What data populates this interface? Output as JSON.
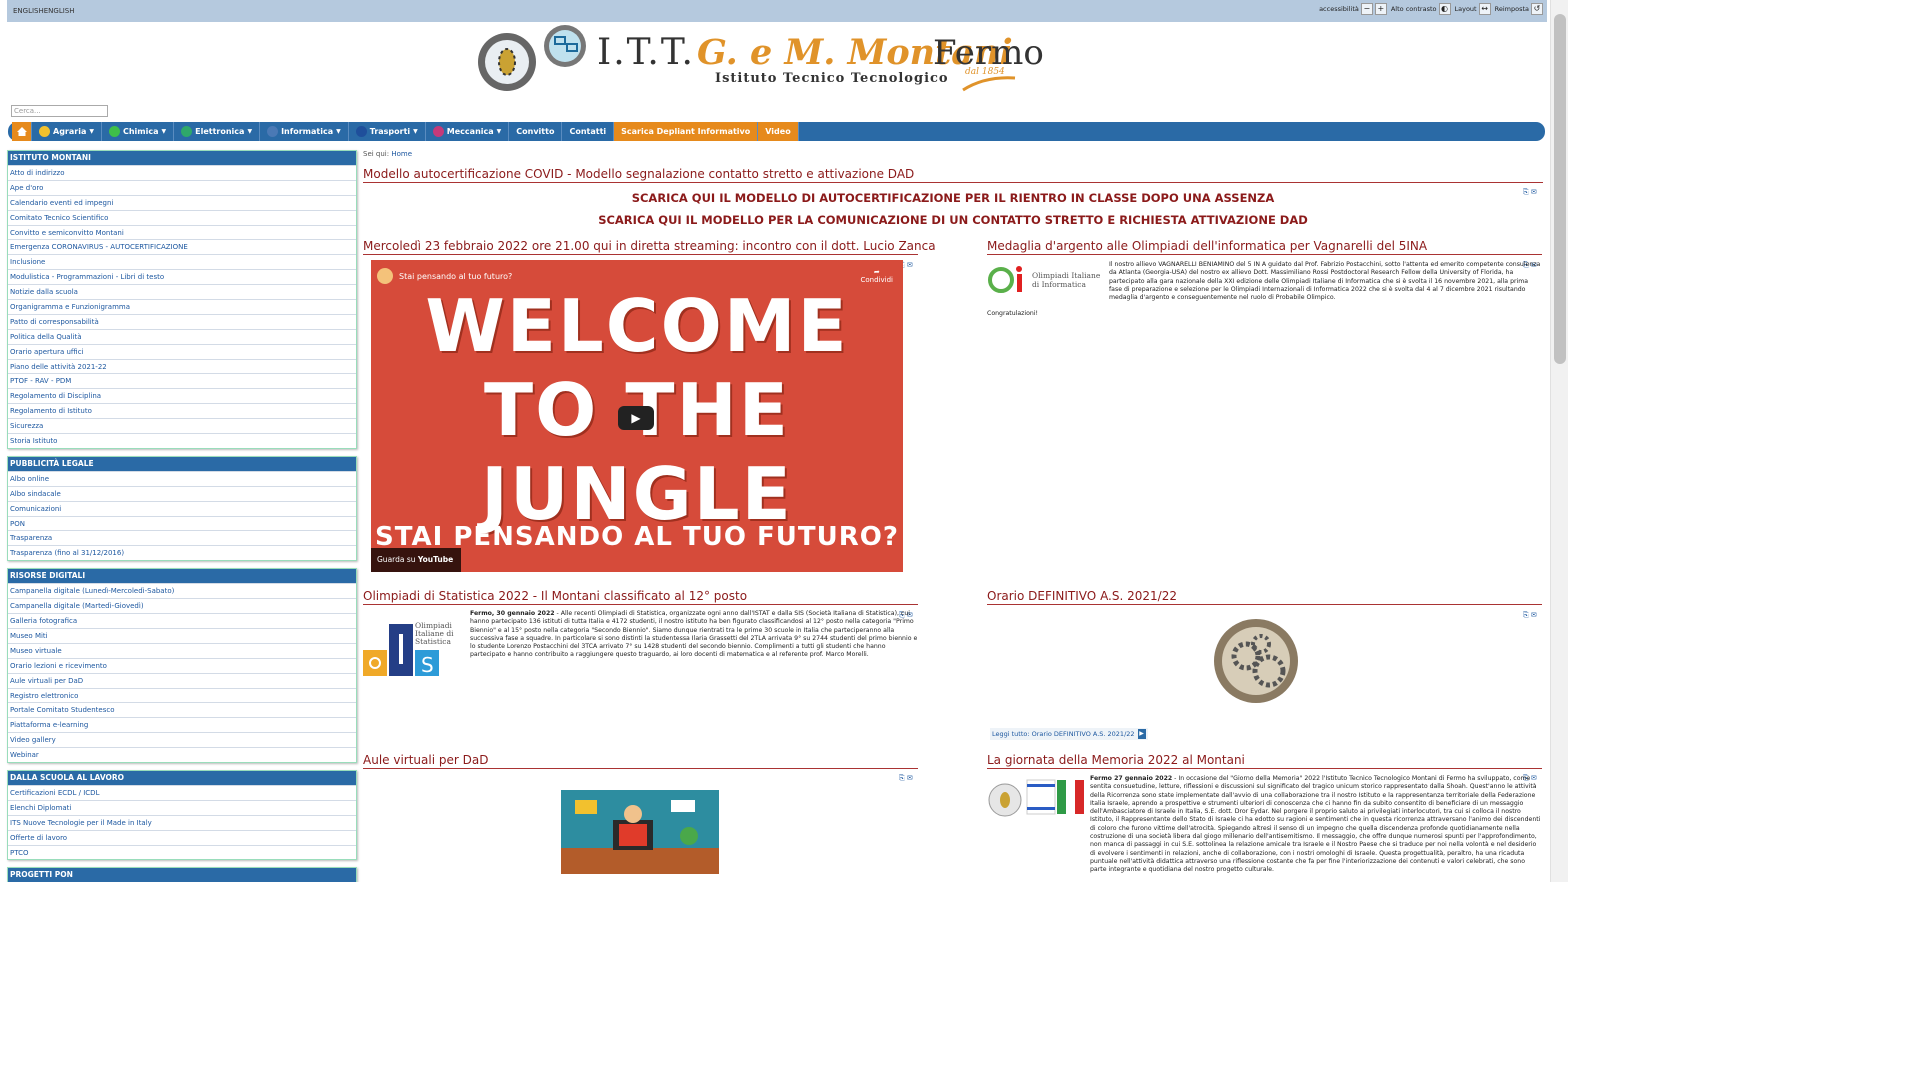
{
  "topbar": {
    "language": "ENGLISHENGLISH",
    "accessibility_label": "accessibilità",
    "zoom_out_icon": "zoom-out-icon",
    "zoom_in_icon": "zoom-in-icon",
    "contrast_label": "Alto contrasto",
    "layout_label": "Layout",
    "reset_label": "Reimposta"
  },
  "header": {
    "logo_prefix": "I.T.T.",
    "logo_name": "G. e M. Montani",
    "logo_city": "Fermo",
    "logo_subtitle": "Istituto Tecnico Tecnologico",
    "logo_since": "dal 1854"
  },
  "search": {
    "placeholder": "Cerca..."
  },
  "nav": [
    {
      "label": "Agraria",
      "color": "#f2c12e"
    },
    {
      "label": "Chimica",
      "color": "#3fbf4a"
    },
    {
      "label": "Elettronica",
      "color": "#2fa86b"
    },
    {
      "label": "Informatica",
      "color": "#4a79b5"
    },
    {
      "label": "Trasporti",
      "color": "#1f4f9b"
    },
    {
      "label": "Meccanica",
      "color": "#c43a7a"
    },
    {
      "label": "Convitto"
    },
    {
      "label": "Contatti"
    },
    {
      "label": "Scarica Depliant Informativo"
    },
    {
      "label": "Video"
    }
  ],
  "sidebar": [
    {
      "title": "ISTITUTO MONTANI",
      "items": [
        "Atto di indirizzo",
        "Ape d'oro",
        "Calendario eventi ed impegni",
        "Comitato Tecnico Scientifico",
        "Convitto e semiconvitto Montani",
        "Emergenza CORONAVIRUS - AUTOCERTIFICAZIONE",
        "Inclusione",
        "Modulistica - Programmazioni - Libri di testo",
        "Notizie dalla scuola",
        "Organigramma e Funzionigramma",
        "Patto di corresponsabilità",
        "Politica della Qualità",
        "Orario apertura uffici",
        "Piano delle attività 2021-22",
        "PTOF - RAV - PDM",
        "Regolamento di Disciplina",
        "Regolamento di Istituto",
        "Sicurezza",
        "Storia Istituto"
      ]
    },
    {
      "title": "PUBBLICITÀ LEGALE",
      "items": [
        "Albo online",
        "Albo sindacale",
        "Comunicazioni",
        "PON",
        "Trasparenza",
        "Trasparenza (fino al 31/12/2016)"
      ]
    },
    {
      "title": "RISORSE DIGITALI",
      "items": [
        "Campanella digitale (Lunedì-Mercoledì-Sabato)",
        "Campanella digitale (Martedì-Giovedì)",
        "Galleria fotografica",
        "Museo Miti",
        "Museo virtuale",
        "Orario lezioni e ricevimento",
        "Aule virtuali per DaD",
        "Registro elettronico",
        "Portale Comitato Studentesco",
        "Piattaforma e-learning",
        "Video gallery",
        "Webinar"
      ]
    },
    {
      "title": "DALLA SCUOLA AL LAVORO",
      "items": [
        "Certificazioni ECDL / ICDL",
        "Elenchi Diplomati",
        "ITS Nuove Tecnologie per il Made in Italy",
        "Offerte di lavoro",
        "PTCO"
      ]
    },
    {
      "title": "PROGETTI PON",
      "items": []
    }
  ],
  "main": {
    "breadcrumb_prefix": "Sei qui:",
    "breadcrumb_home": "Home",
    "covid_title": "Modello autocertificazione COVID - Modello segnalazione contatto stretto e attivazione DAD",
    "cta1": "SCARICA QUI IL MODELLO DI AUTOCERTIFICAZIONE PER IL RIENTRO IN CLASSE DOPO UNA ASSENZA",
    "cta2": "SCARICA QUI IL MODELLO PER LA COMUNICAZIONE DI UN CONTATTO STRETTO E RICHIESTA ATTIVAZIONE DAD",
    "streaming_title": "Mercoledì 23 febbraio 2022 ore 21.00 qui in diretta streaming: incontro con il dott. Lucio Zanca",
    "video": {
      "channel_title": "Stai pensando al tuo futuro?",
      "share": "Condividi",
      "big_text_1": "WELCOME",
      "big_text_2": "TO THE",
      "big_text_3": "JUNGLE",
      "sub_text": "STAI PENSANDO AL TUO FUTURO?",
      "watch_on": "Guarda su",
      "youtube": "YouTube"
    },
    "medal_title": "Medaglia d'argento alle Olimpiadi dell'informatica per Vagnarelli del 5INA",
    "medal_logo_text": "Olimpiadi Italiane di Informatica",
    "medal_text": "Il nostro allievo VAGNARELLI BENIAMINO del 5 IN A guidato dal Prof. Fabrizio Postacchini, sotto l'attenta ed emerito competente consulenza da Atlanta (Georgia-USA) del nostro ex allievo Dott. Massimiliano Rossi Postdoctoral Research Fellow della University of Florida, ha partecipato alla gara nazionale della XXI edizione delle Olimpiadi Italiane di Informatica che si è svolta il 16 novembre 2021, alla prima fase di preparazione e selezione per le Olimpiadi Internazionali di Informatica 2022 che si è svolta dal 4 al 7 dicembre 2021 risultando medaglia d'argento e conseguentemente nel ruolo di Probabile Olimpico.",
    "medal_congrats": "Congratulazioni!",
    "stat_title": "Olimpiadi di Statistica 2022 - Il Montani classificato al 12° posto",
    "stat_logo_text": "Olimpiadi Italiane di Statistica",
    "stat_lead": "Fermo, 30 gennaio 2022",
    "stat_text": " - Alle recenti Olimpiadi di Statistica, organizzate ogni anno dall'ISTAT e dalla SIS (Società Italiana di Statistica), cui hanno partecipato 136 istituti di tutta Italia e 4172 studenti, il nostro istituto ha ben figurato classificandosi al 12° posto nella categoria \"Primo Biennio\" e al 15° posto nella categoria \"Secondo Biennio\". Siamo dunque rientrati tra le prime 30 scuole in Italia che parteciperanno alla successiva fase a squadre. In particolare si sono distinti la studentessa Ilaria Grassetti del 2TLA arrivata 9° su 2744 studenti del primo biennio e lo studente Lorenzo Postacchini del 3TCA arrivato 7° su 1428 studenti del secondo biennio. Complimenti a tutti gli studenti che hanno partecipato e hanno contribuito a raggiungere questo traguardo, ai loro docenti di matematica e al referente prof. Marco Morelli.",
    "orario_title": "Orario DEFINITIVO A.S. 2021/22",
    "orario_read_more": "Leggi tutto: Orario DEFINITIVO A.S. 2021/22",
    "aule_title": "Aule virtuali per DaD",
    "memoria_title": "La giornata della Memoria 2022 al Montani",
    "memoria_lead": "Fermo 27 gennaio 2022",
    "memoria_text": " - In occasione del \"Giorno della Memoria\" 2022 l'Istituto Tecnico Tecnologico Montani di Fermo ha sviluppato, come sentita consuetudine, letture, riflessioni e discussioni sul significato del tragico unicum storico rappresentato dalla Shoah. Quest'anno le attività della Ricorrenza sono state implementate dall'avvio di una collaborazione tra il nostro Istituto e la rappresentanza territoriale della Federazione Italia Israele, aprendo a prospettive e strumenti ulteriori di conoscenza che ci hanno fin da subito consentito di beneficiare di un messaggio dell'Ambasciatore di Israele in Italia, S.E. dott. Dror Eydar. Nel porgere il proprio saluto ai privilegiati interlocutori, tra cui si colloca il nostro Istituto, il Rappresentante dello Stato di Israele ci ha edotto su ragioni e sentimenti che in questa ricorrenza attraversano l'animo dei discendenti di coloro che furono vittime dell'atrocità. Spiegando altresì il senso di un impegno che quella discendenza profonde quotidianamente nella costruzione di una società libera dal giogo millenario dell'antisemitismo. Il messaggio, che offre dunque numerosi spunti per l'approfondimento, non manca di passaggi in cui S.E. sottolinea la relazione amicale tra Israele e il Nostro Paese che si traduce per noi nella volontà e nel desiderio di evolvere i sentimenti in relazioni, anche di collaborazione, con i nostri omologhi di Israele. Questa progettualità, peraltro, ha una ricaduta puntuale nell'attività didattica attraverso una riflessione costante che fa per fine l'interiorizzazione dei contenuti e valori celebrati, che sono parte integrante e quotidiana del nostro progetto culturale."
  }
}
